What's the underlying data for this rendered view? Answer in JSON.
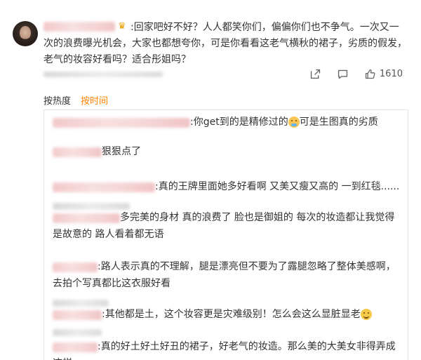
{
  "post": {
    "badge_icon": "crown-icon",
    "text": ":回家吧好不好？人人都笑你们，偏偏你们也不争气。一次又一次的浪费曝光机会，大家也都想夸你，可是你看看这老气横秋的裙子，劣质的假发，老气的妆容好看吗？适合彤姐吗？",
    "actions": {
      "share_icon": "share-icon",
      "comment_icon": "comment-icon",
      "like_icon": "thumbs-up-icon",
      "like_count": "1610"
    }
  },
  "sort": {
    "by_hot": "按热度",
    "by_time": "按时间"
  },
  "comments": [
    {
      "text": ":你get到的是精修过的",
      "emoji": "cry-laugh-emoji",
      "text2": "可是生图真的劣质"
    },
    {
      "text": "狠狠点了"
    },
    {
      "text": ":真的王牌里面她多好看啊 又美又瘦又高的 一到红毯......"
    },
    {
      "text": "多完美的身材 真的浪费了 脸也是御姐的 每次的妆造都让我觉得是故意的 路人看着都无语"
    },
    {
      "text": ":路人表示真的不理解，腿是漂亮但不要为了露腿忽略了整体美感啊，去拍个写真都比这衣服好看"
    },
    {
      "text": ":其他都是土，这个妆容更是灾难级别！怎么会这么显脏显老",
      "emoji": "sweat-smile-emoji"
    },
    {
      "text": ":真的好土好土好丑的裙子，好老气的妆造。那么美的大美女非得弄成这样"
    }
  ]
}
